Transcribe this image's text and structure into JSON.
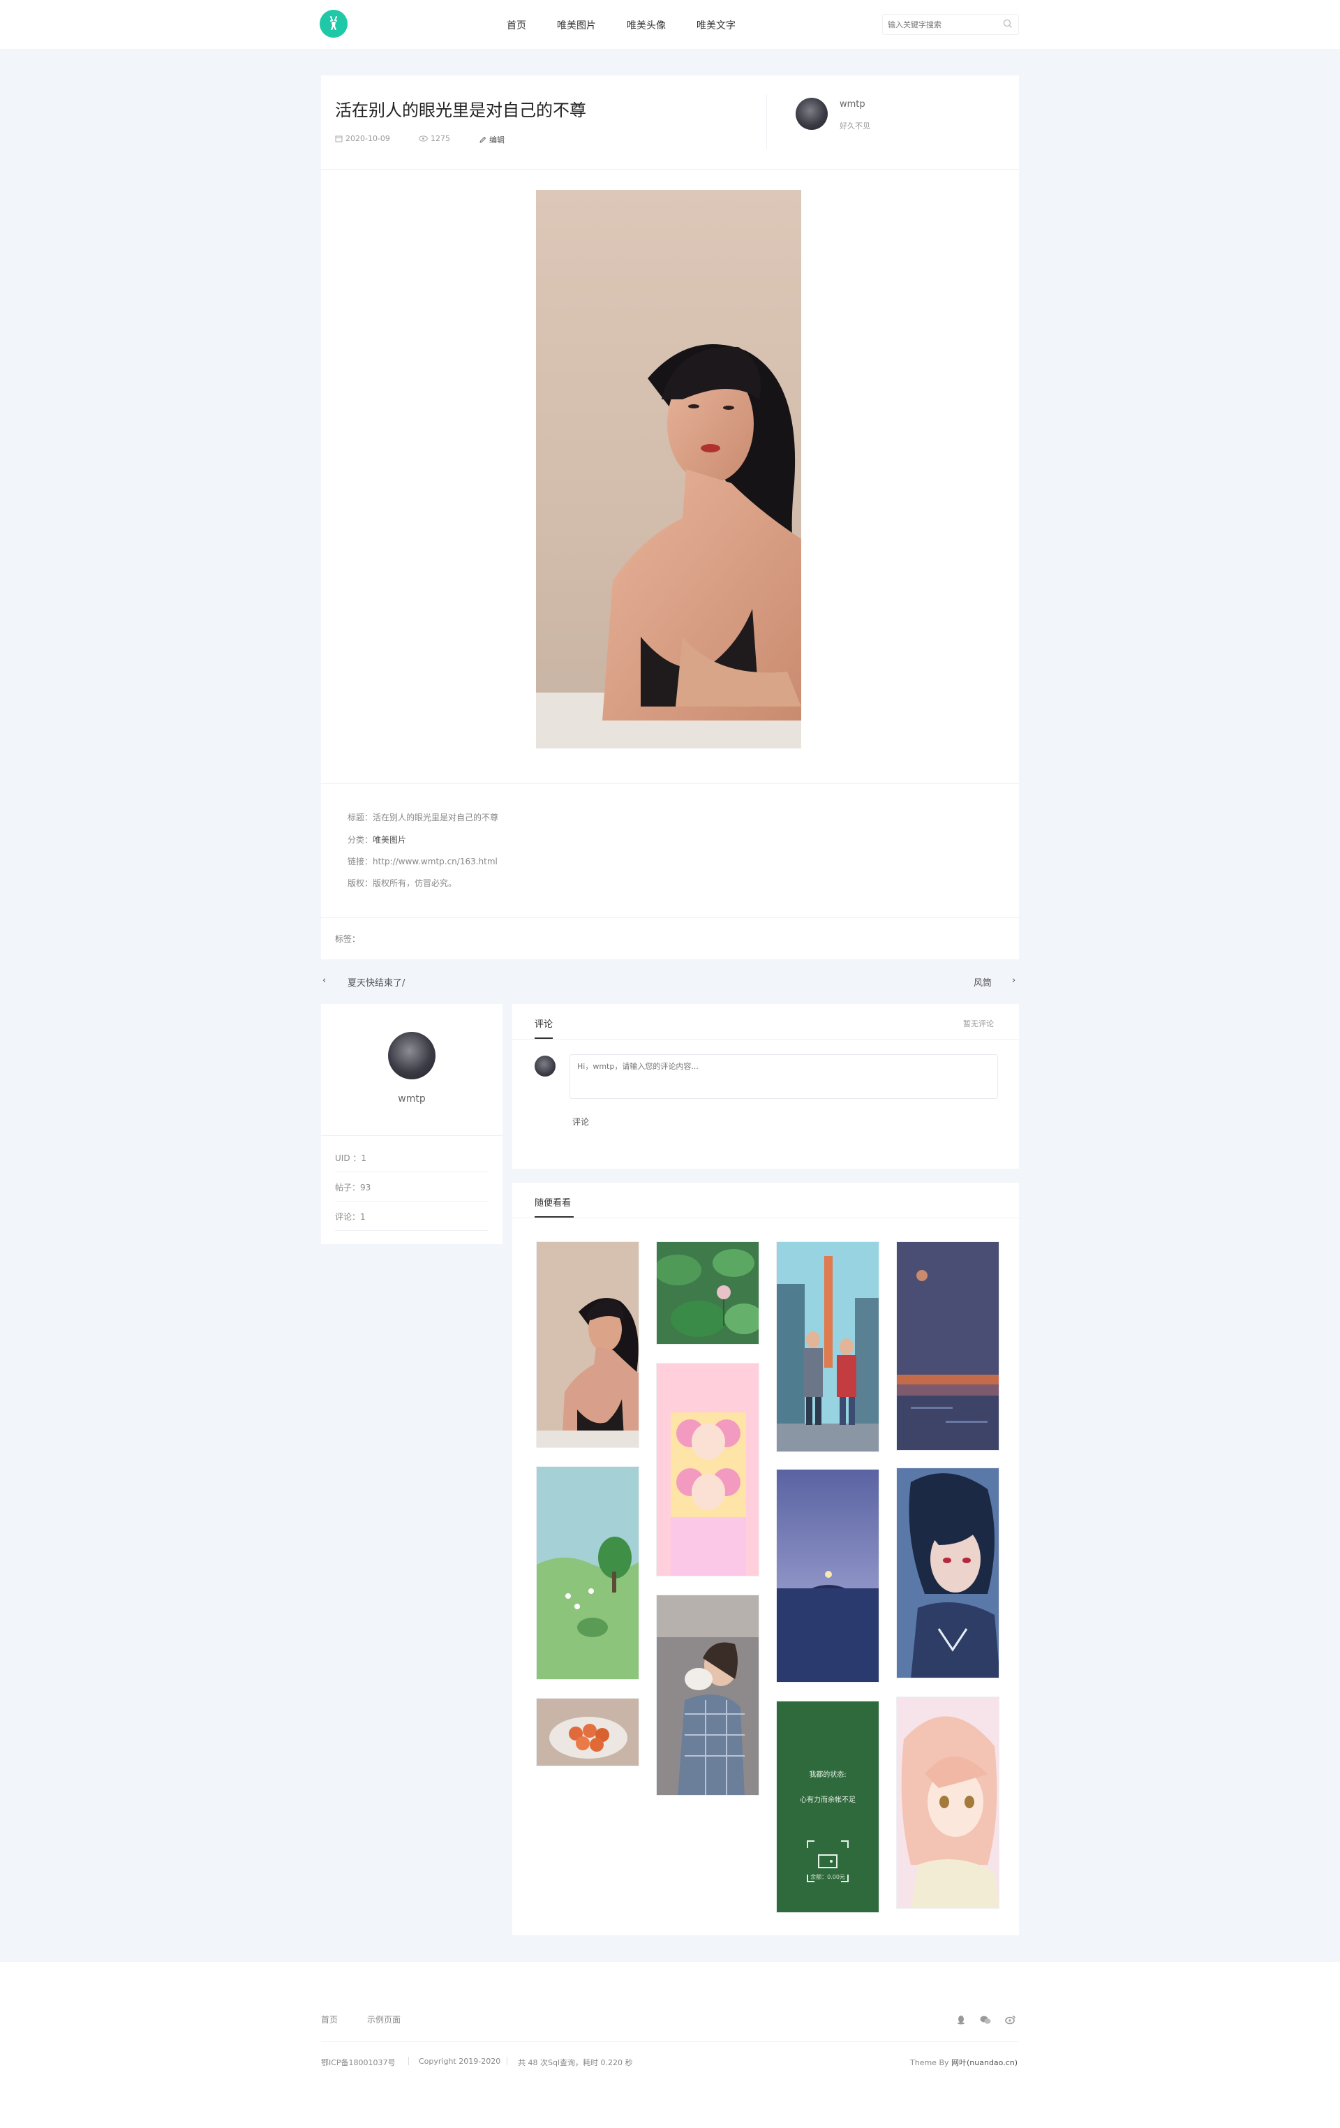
{
  "nav": {
    "items": [
      {
        "label": "首页"
      },
      {
        "label": "唯美图片"
      },
      {
        "label": "唯美头像"
      },
      {
        "label": "唯美文字"
      }
    ]
  },
  "search": {
    "placeholder": "输入关键字搜索"
  },
  "post": {
    "title": "活在别人的眼光里是对自己的不尊",
    "date": "2020-10-09",
    "views": "1275",
    "edit_label": "编辑",
    "author": {
      "name": "wmtp",
      "status": "好久不见"
    }
  },
  "info": {
    "title_label": "标题：",
    "title_value": "活在别人的眼光里是对自己的不尊",
    "category_label": "分类：",
    "category_value": "唯美图片",
    "link_label": "链接：",
    "link_value": "http://www.wmtp.cn/163.html",
    "copyright_label": "版权：",
    "copyright_value": "版权所有，仿冒必究。",
    "tags_label": "标签："
  },
  "prevnext": {
    "prev_icon": "‹",
    "prev_title": "夏天快结束了/",
    "next_title": "风筒",
    "next_icon": "›"
  },
  "profile": {
    "name": "wmtp",
    "stats": [
      {
        "label": "UID ：1"
      },
      {
        "label": "帖子：93"
      },
      {
        "label": "评论：1"
      }
    ]
  },
  "comments": {
    "title": "评论",
    "count_text": "暂无评论",
    "placeholder": "Hi，wmtp，请输入您的评论内容...",
    "submit_label": "评论"
  },
  "gallery": {
    "title": "随便看看",
    "overlay_line1": "我都的状态:",
    "overlay_line2": "心有力而余帐不足",
    "overlay_line3": "余额：0.00元"
  },
  "footer": {
    "links": [
      {
        "label": "首页"
      },
      {
        "label": "示例页面"
      }
    ],
    "icp": "鄂ICP备18001037号",
    "copyright": "Copyright 2019-2020",
    "stats": "共 48 次Sql查询，耗时 0.220 秒",
    "theme_prefix": "Theme By ",
    "theme_name": "网叶(nuandao.cn)"
  },
  "colors": {
    "accent": "#1fc8a6",
    "page_bg": "#f2f5fa"
  }
}
